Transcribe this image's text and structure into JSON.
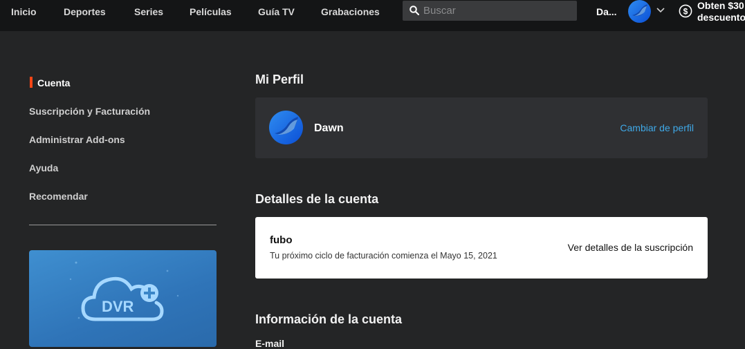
{
  "nav": {
    "items": [
      "Inicio",
      "Deportes",
      "Series",
      "Películas",
      "Guía TV",
      "Grabaciones"
    ],
    "search_placeholder": "Buscar",
    "user_name": "Da...",
    "promo_line1": "Obten $30",
    "promo_line2": "descuento"
  },
  "sidebar": {
    "items": [
      "Cuenta",
      "Suscripción y Facturación",
      "Administrar Add-ons",
      "Ayuda",
      "Recomendar"
    ],
    "active_item": "Cuenta",
    "dvr_label": "DVR"
  },
  "main": {
    "profile_title": "Mi Perfil",
    "profile_name": "Dawn",
    "change_profile": "Cambiar de perfil",
    "account_details_title": "Detalles de la cuenta",
    "subscription_name": "fubo",
    "billing_cycle_text": "Tu próximo ciclo de facturación comienza el Mayo 15, 2021",
    "subscription_link": "Ver detalles de la suscripción",
    "account_info_title": "Información de la cuenta",
    "email_label": "E-mail"
  },
  "colors": {
    "accent_orange": "#fa4616",
    "link_blue": "#3fa9e8",
    "background": "#242526",
    "nav_background": "#141516"
  }
}
